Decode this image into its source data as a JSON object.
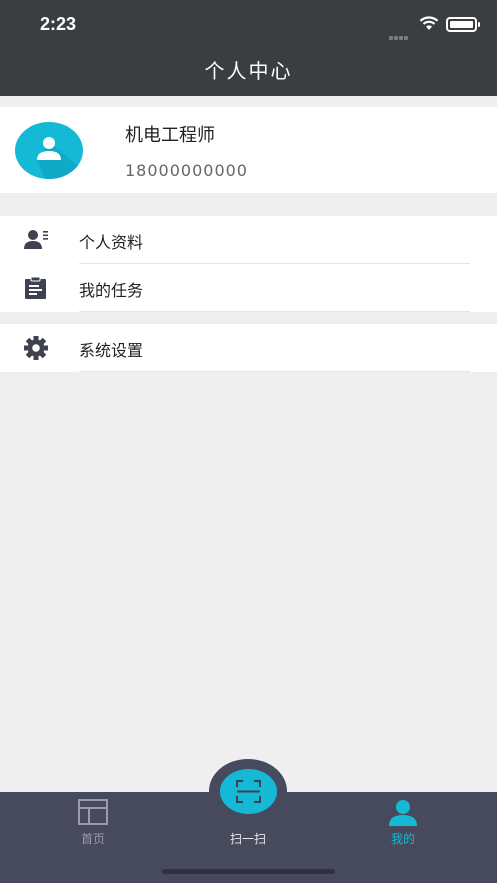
{
  "status_bar": {
    "time": "2:23"
  },
  "nav": {
    "title": "个人中心"
  },
  "profile": {
    "name": "机电工程师",
    "phone": "18000000000"
  },
  "menu": [
    {
      "label": "个人资料",
      "icon": "user-card-icon"
    },
    {
      "label": "我的任务",
      "icon": "clipboard-icon"
    },
    {
      "label": "系统设置",
      "icon": "gear-icon"
    }
  ],
  "tabbar": {
    "home": "首页",
    "scan": "扫一扫",
    "mine": "我的"
  },
  "colors": {
    "header": "#3a3e41",
    "accent": "#14b9d6",
    "tabbar": "#474a5c",
    "background": "#efefef"
  }
}
